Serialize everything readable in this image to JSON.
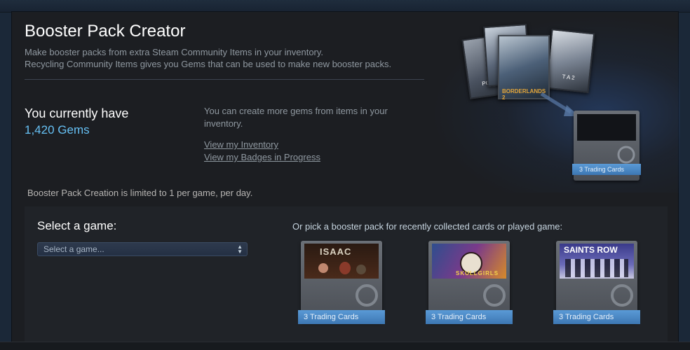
{
  "header": {
    "title": "Booster Pack Creator",
    "description_line1": "Make booster packs from extra Steam Community Items in your inventory.",
    "description_line2": "Recycling Community Items gives you Gems that can be used to make new booster packs."
  },
  "gems": {
    "label": "You currently have",
    "count": "1,420 Gems",
    "more_text": "You can create more gems from items in your inventory.",
    "link_inventory": "View my Inventory",
    "link_badges": "View my Badges in Progress"
  },
  "limit_text": "Booster Pack Creation is limited to 1 per game, per day.",
  "selector": {
    "label": "Select a game:",
    "value": "Select a game..."
  },
  "recent": {
    "label": "Or pick a booster pack for recently collected cards or played game:",
    "packs": [
      {
        "game": "ISAAC",
        "ribbon": "3 Trading Cards"
      },
      {
        "game": "SKULLGIRLS",
        "ribbon": "3 Trading Cards"
      },
      {
        "game": "SAINTS ROW",
        "ribbon": "3 Trading Cards"
      }
    ]
  },
  "hero": {
    "pack_ribbon": "3 Trading Cards",
    "card_texts": [
      "PO",
      "BORDERLANDS 2",
      "T A 2"
    ]
  },
  "colors": {
    "accent": "#66c0f4",
    "ribbon": "#4a8ac8",
    "background": "#1c1e22"
  }
}
